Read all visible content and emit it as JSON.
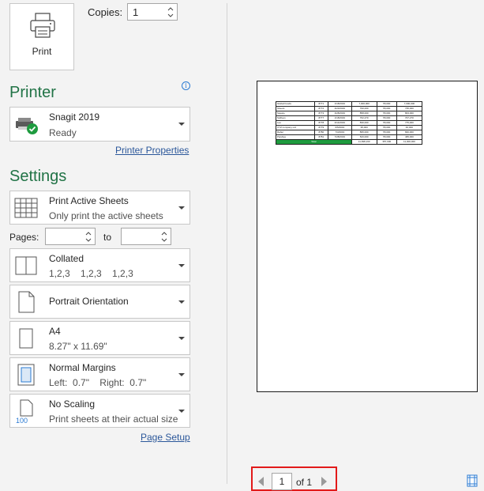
{
  "print": {
    "button_label": "Print"
  },
  "copies": {
    "label": "Copies:",
    "value": "1"
  },
  "printer": {
    "section_title": "Printer",
    "name": "Snagit 2019",
    "status": "Ready",
    "properties_link": "Printer Properties",
    "info_glyph": "i"
  },
  "settings": {
    "section_title": "Settings",
    "print_what": {
      "title": "Print Active Sheets",
      "subtitle": "Only print the active sheets"
    },
    "pages": {
      "label": "Pages:",
      "to_label": "to",
      "from_value": "",
      "to_value": ""
    },
    "collation": {
      "title": "Collated",
      "subtitle": "1,2,3    1,2,3    1,2,3"
    },
    "orientation": {
      "title": "Portrait Orientation"
    },
    "paper": {
      "title": "A4",
      "subtitle": "8.27\" x 11.69\""
    },
    "margins": {
      "title": "Normal Margins",
      "subtitle": "Left:  0.7\"    Right:  0.7\""
    },
    "scaling": {
      "title": "No Scaling",
      "subtitle": "Print sheets at their actual size",
      "icon_text": "100"
    },
    "page_setup_link": "Page Setup"
  },
  "preview": {
    "table_rows": [
      [
        "Global Foods",
        "8771",
        "1/18/2019",
        "7,000,000",
        "55,000",
        "7,000,000"
      ],
      [
        "Sheets",
        "8772",
        "3/23/2019",
        "790,000",
        "55,000",
        "735,000"
      ],
      [
        "Square",
        "8773",
        "3/28/2019",
        "858,000",
        "55,000",
        "803,000"
      ],
      [
        "Sullivan",
        "8777",
        "1/18/2019",
        "762,270",
        "55,000",
        "707,270"
      ],
      [
        "Leo",
        "8778",
        "2/14/2019",
        "830,000",
        "55,000",
        "775,000"
      ],
      [
        "XYZ company Ltd",
        "8779",
        "6/5/2019",
        "95,000",
        "55,000",
        "40,000"
      ],
      [
        "Rahul",
        "8780",
        "7/3/2019",
        "895,000",
        "55,000",
        "840,000"
      ],
      [
        "Pandiya",
        "8781",
        "7/28/2019",
        "520,000",
        "55,000",
        "465,000"
      ]
    ],
    "total_row": {
      "label": "Total",
      "amount": "11,698,160",
      "fee": "357,000",
      "net": "11,000,000"
    }
  },
  "navigation": {
    "current_page": "1",
    "of_label": "of 1"
  },
  "colors": {
    "accent_green": "#217346",
    "link_blue": "#2b579a",
    "highlight_red": "#e21a1a"
  }
}
